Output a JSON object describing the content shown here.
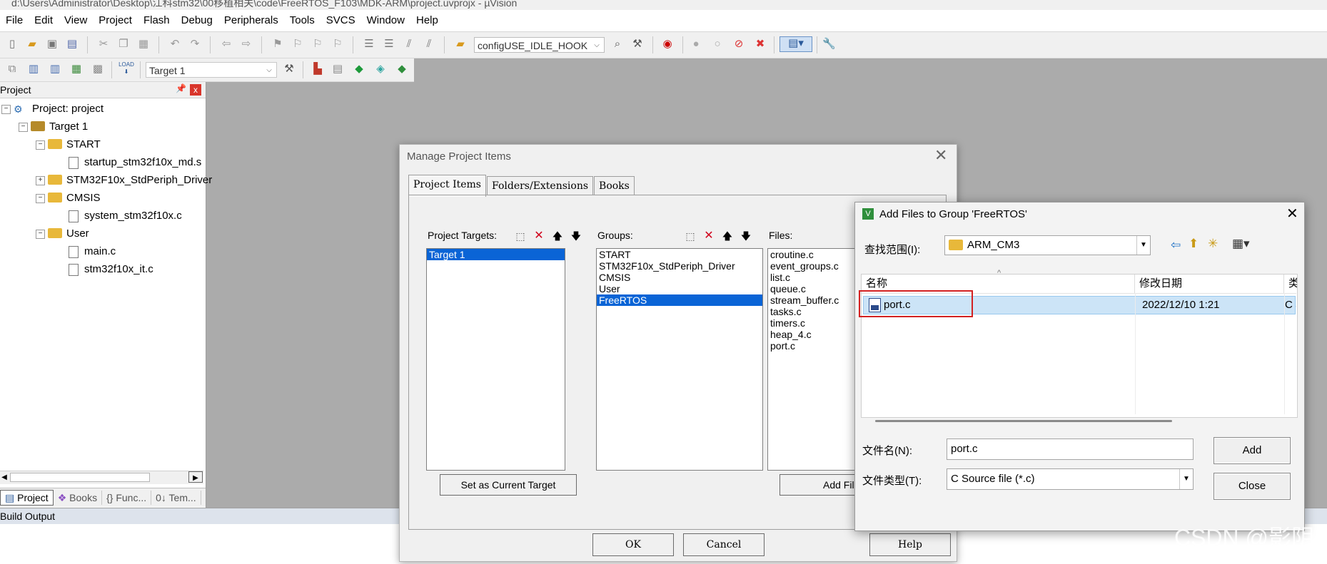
{
  "window": {
    "title": "d:\\Users\\Administrator\\Desktop\\江科stm32\\00移植相关\\code\\FreeRTOS_F103\\MDK-ARM\\project.uvprojx - µVision"
  },
  "menu": [
    "File",
    "Edit",
    "View",
    "Project",
    "Flash",
    "Debug",
    "Peripherals",
    "Tools",
    "SVCS",
    "Window",
    "Help"
  ],
  "toolbar": {
    "find_combo": "configUSE_IDLE_HOOK",
    "target_combo": "Target 1",
    "load_label": "LOAD"
  },
  "project_panel": {
    "title": "Project",
    "pin": "ᵖ",
    "close": "x",
    "tree": [
      {
        "label": "Project: project"
      },
      {
        "label": "Target 1"
      },
      {
        "label": "START"
      },
      {
        "label": "startup_stm32f10x_md.s"
      },
      {
        "label": "STM32F10x_StdPeriph_Driver"
      },
      {
        "label": "CMSIS"
      },
      {
        "label": "system_stm32f10x.c"
      },
      {
        "label": "User"
      },
      {
        "label": "main.c"
      },
      {
        "label": "stm32f10x_it.c"
      }
    ],
    "tabs": [
      "Project",
      "Books",
      "{} Func...",
      "0↓ Tem..."
    ]
  },
  "build_output": {
    "title": "Build Output"
  },
  "manage_dialog": {
    "title": "Manage Project Items",
    "tabs": [
      "Project Items",
      "Folders/Extensions",
      "Books"
    ],
    "targets_label": "Project Targets:",
    "groups_label": "Groups:",
    "files_label": "Files:",
    "targets": [
      "Target 1"
    ],
    "groups": [
      "START",
      "STM32F10x_StdPeriph_Driver",
      "CMSIS",
      "User",
      "FreeRTOS"
    ],
    "files": [
      "croutine.c",
      "event_groups.c",
      "list.c",
      "queue.c",
      "stream_buffer.c",
      "tasks.c",
      "timers.c",
      "heap_4.c",
      "port.c"
    ],
    "set_current_button": "Set as Current Target",
    "add_files_button": "Add Files...",
    "ok_button": "OK",
    "cancel_button": "Cancel",
    "help_button": "Help"
  },
  "add_files_dialog": {
    "title": "Add Files to Group 'FreeRTOS'",
    "look_in_label": "查找范围(I):",
    "look_in_value": "ARM_CM3",
    "col_name": "名称",
    "col_date": "修改日期",
    "col_type": "类",
    "file_name": "port.c",
    "file_date": "2022/12/10 1:21",
    "file_type_short": "C S",
    "filename_label": "文件名(N):",
    "filename_value": "port.c",
    "filetype_label": "文件类型(T):",
    "filetype_value": "C Source file (*.c)",
    "add_button": "Add",
    "close_button": "Close",
    "close_x": "✕"
  },
  "watermark": "CSDN @影阴"
}
